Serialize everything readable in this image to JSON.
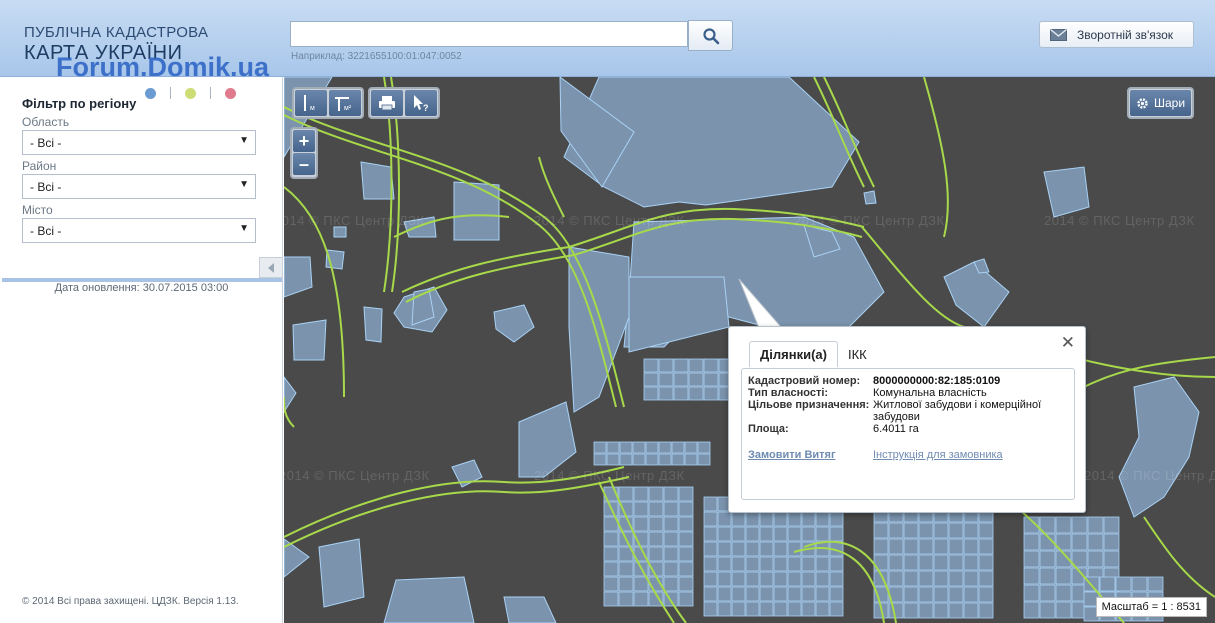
{
  "header": {
    "logo_line1": "ПУБЛІЧНА КАДАСТРОВА",
    "logo_line2": "КАРТА УКРАЇНИ",
    "watermark": "Forum.Domik.ua",
    "search_value": "",
    "search_hint": "Наприклад: 3221655100:01:047:0052",
    "feedback_label": "Зворотній зв'язок"
  },
  "sidebar": {
    "filter_title": "Фільтр по регіону",
    "fields": [
      {
        "label": "Область",
        "value": "- Всі -"
      },
      {
        "label": "Район",
        "value": "- Всі -"
      },
      {
        "label": "Місто",
        "value": "- Всі -"
      }
    ],
    "update_date": "Дата оновлення: 30.07.2015 03:00",
    "copyright": "© 2014 Всі права захищені. ЦДЗК. Версія 1.13.",
    "colors": [
      "#6b9bd1",
      "#cddc74",
      "#e07b8e"
    ]
  },
  "map": {
    "watermark_text": "2014 © ПКС Центр ДЗК",
    "layers_label": "Шари",
    "scale_label": "Масштаб = 1 : 8531",
    "tools": [
      "ruler-icon",
      "area-measure-icon",
      "print-icon",
      "info-cursor-icon"
    ]
  },
  "popup": {
    "tabs": [
      "Ділянки(а)",
      "ІКК"
    ],
    "rows": [
      {
        "key": "Кадастровий номер:",
        "value": "8000000000:82:185:0109"
      },
      {
        "key": "Тип власності:",
        "value": "Комунальна власність"
      },
      {
        "key": "Цільове призначення:",
        "value": "Житлової забудови і комерційної забудови"
      },
      {
        "key": "Площа:",
        "value": "6.4011 га"
      }
    ],
    "link_order": "Замовити Витяг",
    "link_instructions": "Інструкція для замовника"
  },
  "colors": {
    "header": "#b7d0ee",
    "map_background": "#4a4a4a",
    "parcel_fill": "#7b93ad",
    "parcel_stroke": "#a9d2f5",
    "road": "#a7d94a"
  }
}
